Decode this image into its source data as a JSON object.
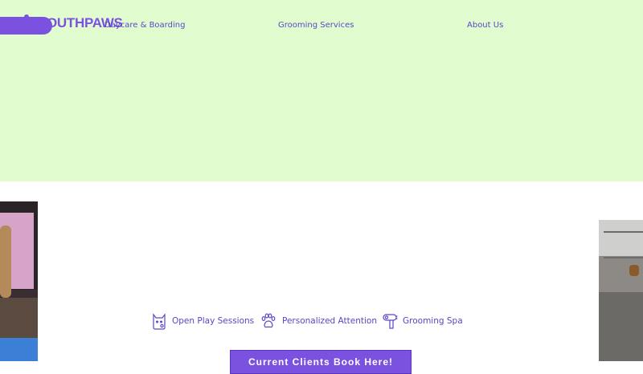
{
  "header": {
    "logo_text": "OUTHPAWS",
    "nav": [
      {
        "label": "Daycare & Boarding"
      },
      {
        "label": "Grooming Services"
      },
      {
        "label": "About Us"
      }
    ]
  },
  "features": [
    {
      "label": "Open Play Sessions",
      "icon": "cat-face-icon"
    },
    {
      "label": "Personalized Attention",
      "icon": "paw-print-icon"
    },
    {
      "label": "Grooming Spa",
      "icon": "hair-dryer-icon"
    }
  ],
  "cta": {
    "label": "Current Clients Book Here!"
  },
  "colors": {
    "hero_bg": "#e1fdd0",
    "accent": "#7b52e0",
    "nav_text": "#5a46c8"
  }
}
